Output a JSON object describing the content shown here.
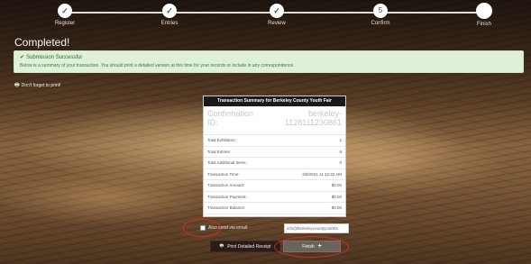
{
  "steps": [
    {
      "label": "Register",
      "state": "done"
    },
    {
      "label": "Entries",
      "state": "done"
    },
    {
      "label": "Review",
      "state": "done"
    },
    {
      "label": "Confirm",
      "state": "done",
      "marker": "5"
    },
    {
      "label": "Finish",
      "state": "current"
    }
  ],
  "page_title": "Completed!",
  "alert": {
    "title": "Submission Successful",
    "text": "Below is a summary of your transaction. You should print a detailed version at this time for your records or include in any correspondence."
  },
  "reminder": "Don't forget to print!",
  "summary": {
    "header": "Transaction Summary for Berkeley County Youth Fair",
    "confirmation_label": "Confirmation ID:",
    "confirmation_value_line1": "berkeley-",
    "confirmation_value_line2": "1128111230861",
    "rows": [
      {
        "label": "Total Exhibitors:",
        "value": "1"
      },
      {
        "label": "Total Entries:",
        "value": "8"
      },
      {
        "label": "Total Additional Items:",
        "value": "0"
      },
      {
        "label": "Transaction Time:",
        "value": "3/8/2021 11:12:32 AM"
      },
      {
        "label": "Transaction Amount:",
        "value": "$0.00"
      },
      {
        "label": "Transaction Payment:",
        "value": "$0.00"
      },
      {
        "label": "Transaction Balance:",
        "value": "$0.00"
      }
    ]
  },
  "email": {
    "checkbox_label": "Also send via email:",
    "value": "info@berkeleycountyyouthfa"
  },
  "buttons": {
    "print": "Print Detailed Receipt",
    "finish": "Finish"
  },
  "colors": {
    "alert_bg": "#dff0d8",
    "annotation": "#d42a2a"
  }
}
